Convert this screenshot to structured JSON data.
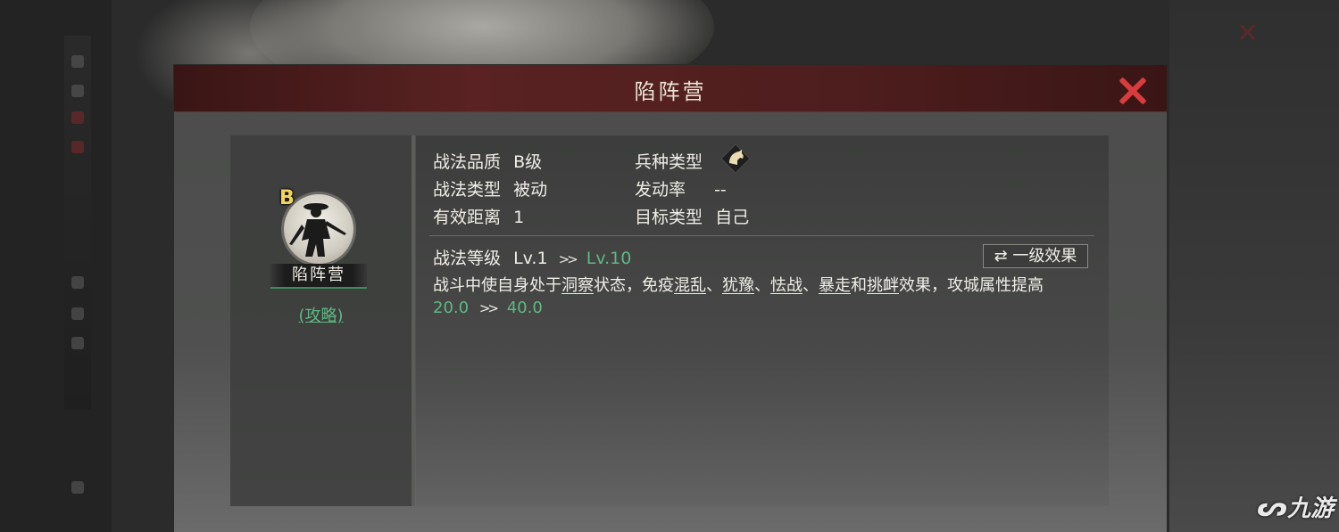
{
  "dialog": {
    "title": "陷阵营"
  },
  "skill": {
    "grade_badge": "B",
    "name": "陷阵营",
    "guide_link": "(攻略)"
  },
  "info": {
    "quality_label": "战法品质",
    "quality_value": "B级",
    "unit_type_label": "兵种类型",
    "unit_type_icon": "cavalry-horse-icon",
    "tactic_type_label": "战法类型",
    "tactic_type_value": "被动",
    "trigger_rate_label": "发动率",
    "trigger_rate_value": "--",
    "range_label": "有效距离",
    "range_value": "1",
    "target_label": "目标类型",
    "target_value": "自己",
    "level_label": "战法等级",
    "level_from": "Lv.1",
    "level_arrow": ">>",
    "level_to": "Lv.10",
    "effect_button": "一级效果",
    "effect_button_icon": "swap-arrows-icon"
  },
  "description": {
    "part1": "战斗中使自身处于",
    "term1": "洞察",
    "part2": "状态，免疫",
    "term2": "混乱",
    "sep1": "、",
    "term3": "犹豫",
    "sep2": "、",
    "term4": "怯战",
    "sep3": "、",
    "term5": "暴走",
    "part3": "和",
    "term6": "挑衅",
    "part4": "效果，攻城属性提高",
    "value_from": "20.0",
    "value_arrow": ">>",
    "value_to": "40.0"
  },
  "watermark": {
    "text": "九游"
  },
  "colors": {
    "header": "#5a2222",
    "close": "#d93c3c",
    "accent_green": "#5fb884",
    "grade_yellow": "#f2d45c"
  }
}
